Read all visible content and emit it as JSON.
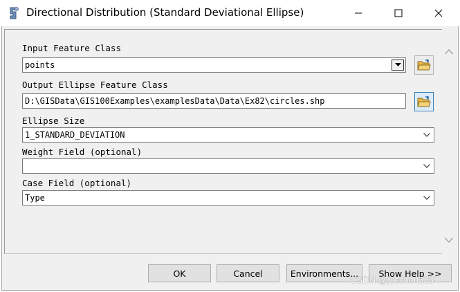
{
  "window": {
    "title": "Directional Distribution (Standard Deviational Ellipse)",
    "controls": [
      "minimize",
      "maximize",
      "close"
    ]
  },
  "form": {
    "input_feature_class": {
      "label": "Input Feature Class",
      "value": "points"
    },
    "output_ellipse": {
      "label": "Output Ellipse Feature Class",
      "value": "D:\\GISData\\GIS100Examples\\examplesData\\Data\\Ex82\\circles.shp"
    },
    "ellipse_size": {
      "label": "Ellipse Size",
      "value": "1_STANDARD_DEVIATION"
    },
    "weight_field": {
      "label": "Weight Field (optional)",
      "value": ""
    },
    "case_field": {
      "label": "Case Field (optional)",
      "value": "Type"
    }
  },
  "buttons": {
    "ok": "OK",
    "cancel": "Cancel",
    "environments": "Environments...",
    "show_help": "Show Help >>"
  },
  "watermark": "CSDN @juechen333",
  "colors": {
    "folder_accent": "#e8b84a",
    "active_border": "#3c7fb1"
  }
}
